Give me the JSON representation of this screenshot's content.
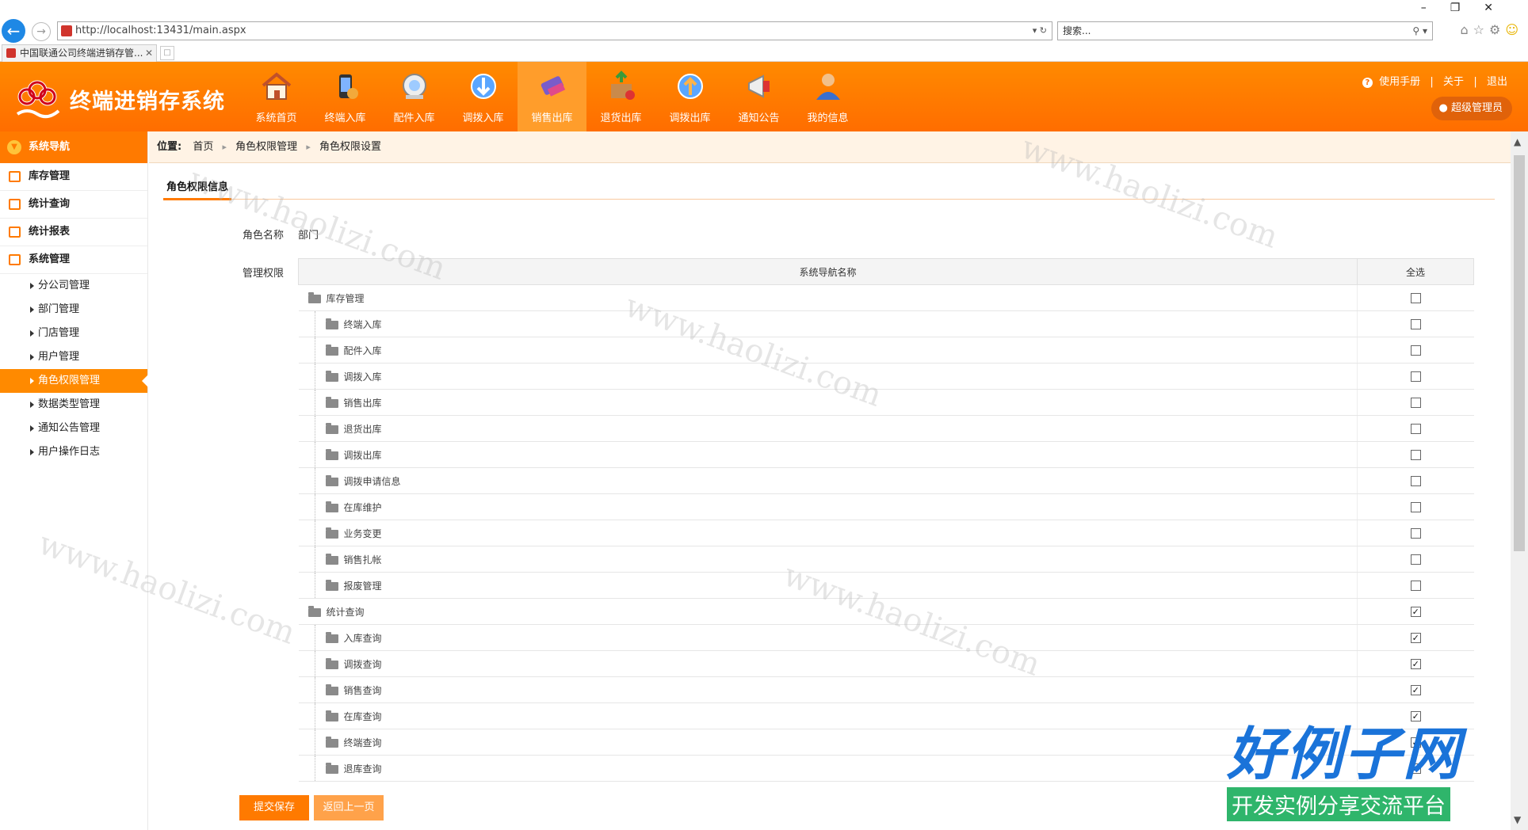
{
  "browser": {
    "url": "http://localhost:13431/main.aspx",
    "search_placeholder": "搜索...",
    "tab_title": "中国联通公司终端进销存管..."
  },
  "header": {
    "title": "终端进销存系统",
    "nav": [
      {
        "label": "系统首页",
        "icon": "home-icon",
        "active": false
      },
      {
        "label": "终端入库",
        "icon": "phone-in-icon",
        "active": false
      },
      {
        "label": "配件入库",
        "icon": "accessory-icon",
        "active": false
      },
      {
        "label": "调拨入库",
        "icon": "transfer-in-icon",
        "active": false
      },
      {
        "label": "销售出库",
        "icon": "sales-out-icon",
        "active": true
      },
      {
        "label": "退货出库",
        "icon": "return-icon",
        "active": false
      },
      {
        "label": "调拨出库",
        "icon": "transfer-out-icon",
        "active": false
      },
      {
        "label": "通知公告",
        "icon": "announcement-icon",
        "active": false
      },
      {
        "label": "我的信息",
        "icon": "user-info-icon",
        "active": false
      }
    ],
    "links": {
      "manual": "使用手册",
      "about": "关于",
      "logout": "退出"
    },
    "admin": "超级管理员"
  },
  "sidebar": {
    "title": "系统导航",
    "groups": [
      {
        "label": "库存管理"
      },
      {
        "label": "统计查询"
      },
      {
        "label": "统计报表"
      },
      {
        "label": "系统管理"
      }
    ],
    "sub_items": [
      {
        "label": "分公司管理",
        "active": false
      },
      {
        "label": "部门管理",
        "active": false
      },
      {
        "label": "门店管理",
        "active": false
      },
      {
        "label": "用户管理",
        "active": false
      },
      {
        "label": "角色权限管理",
        "active": true
      },
      {
        "label": "数据类型管理",
        "active": false
      },
      {
        "label": "通知公告管理",
        "active": false
      },
      {
        "label": "用户操作日志",
        "active": false
      }
    ]
  },
  "breadcrumb": {
    "prefix": "位置:",
    "items": [
      "首页",
      "角色权限管理",
      "角色权限设置"
    ]
  },
  "main": {
    "section_title": "角色权限信息",
    "role_name_label": "角色名称",
    "role_name_value": "部门",
    "perm_label": "管理权限",
    "table_headers": {
      "name": "系统导航名称",
      "check": "全选"
    },
    "rows": [
      {
        "name": "库存管理",
        "level": 0,
        "checked": false
      },
      {
        "name": "终端入库",
        "level": 1,
        "checked": false
      },
      {
        "name": "配件入库",
        "level": 1,
        "checked": false
      },
      {
        "name": "调拨入库",
        "level": 1,
        "checked": false
      },
      {
        "name": "销售出库",
        "level": 1,
        "checked": false
      },
      {
        "name": "退货出库",
        "level": 1,
        "checked": false
      },
      {
        "name": "调拨出库",
        "level": 1,
        "checked": false
      },
      {
        "name": "调拨申请信息",
        "level": 1,
        "checked": false
      },
      {
        "name": "在库维护",
        "level": 1,
        "checked": false
      },
      {
        "name": "业务变更",
        "level": 1,
        "checked": false
      },
      {
        "name": "销售扎帐",
        "level": 1,
        "checked": false
      },
      {
        "name": "报废管理",
        "level": 1,
        "checked": false
      },
      {
        "name": "统计查询",
        "level": 0,
        "checked": true
      },
      {
        "name": "入库查询",
        "level": 1,
        "checked": true
      },
      {
        "name": "调拨查询",
        "level": 1,
        "checked": true
      },
      {
        "name": "销售查询",
        "level": 1,
        "checked": true
      },
      {
        "name": "在库查询",
        "level": 1,
        "checked": true
      },
      {
        "name": "终端查询",
        "level": 1,
        "checked": true
      },
      {
        "name": "退库查询",
        "level": 1,
        "checked": true
      }
    ],
    "buttons": {
      "submit": "提交保存",
      "back": "返回上一页"
    }
  },
  "watermark": {
    "site": "www.haolizi.com",
    "logo_big": "好例子网",
    "logo_small": "开发实例分享交流平台"
  },
  "colors": {
    "brand_orange": "#ff7a00",
    "active_nav": "#ff9d2b"
  }
}
